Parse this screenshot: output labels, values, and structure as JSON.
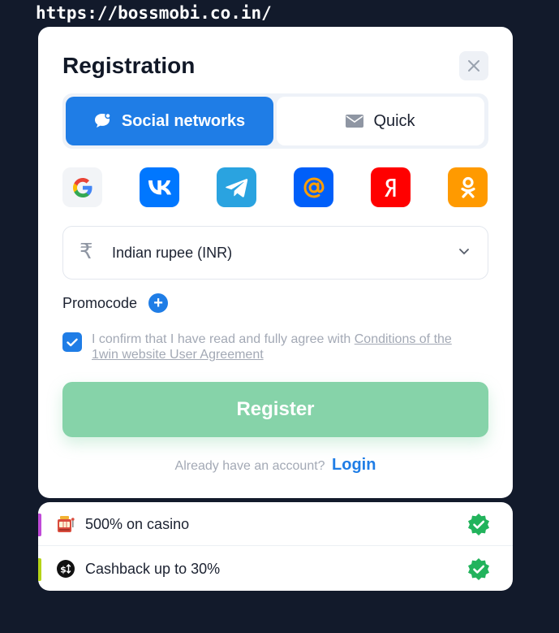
{
  "browser": {
    "url": "https://bossmobi.co.in/"
  },
  "modal": {
    "title": "Registration",
    "close_icon": "close-icon",
    "tabs": [
      {
        "label": "Social networks",
        "icon": "chat-bubble-icon",
        "active": true
      },
      {
        "label": "Quick",
        "icon": "envelope-icon",
        "active": false
      }
    ],
    "social_logins": [
      {
        "name": "google",
        "color": "#ffffff"
      },
      {
        "name": "vk",
        "color": "#0077ff"
      },
      {
        "name": "telegram",
        "color": "#2aa3e0"
      },
      {
        "name": "mail",
        "color": "#005ff9"
      },
      {
        "name": "yandex",
        "color": "#ff0000"
      },
      {
        "name": "odnoklassniki",
        "color": "#ff9a00"
      }
    ],
    "currency": {
      "symbol": "₹",
      "label": "Indian rupee (INR)"
    },
    "promocode": {
      "label": "Promocode",
      "add_symbol": "+"
    },
    "agreement": {
      "checked": true,
      "text": "I confirm that I have read and fully agree with",
      "link": "Conditions of the 1win website User Agreement"
    },
    "register_label": "Register",
    "login_prompt": "Already have an account?",
    "login_link": "Login"
  },
  "bonuses": [
    {
      "text": "500% on casino",
      "icon": "slot-machine-icon",
      "accent": "#c04ad8"
    },
    {
      "text": "Cashback up to 30%",
      "icon": "cashback-icon",
      "accent": "#b5d417"
    }
  ],
  "colors": {
    "primary": "#1f7de6",
    "register": "#86d3a9",
    "badge": "#22b35c",
    "background": "#121a2b"
  }
}
